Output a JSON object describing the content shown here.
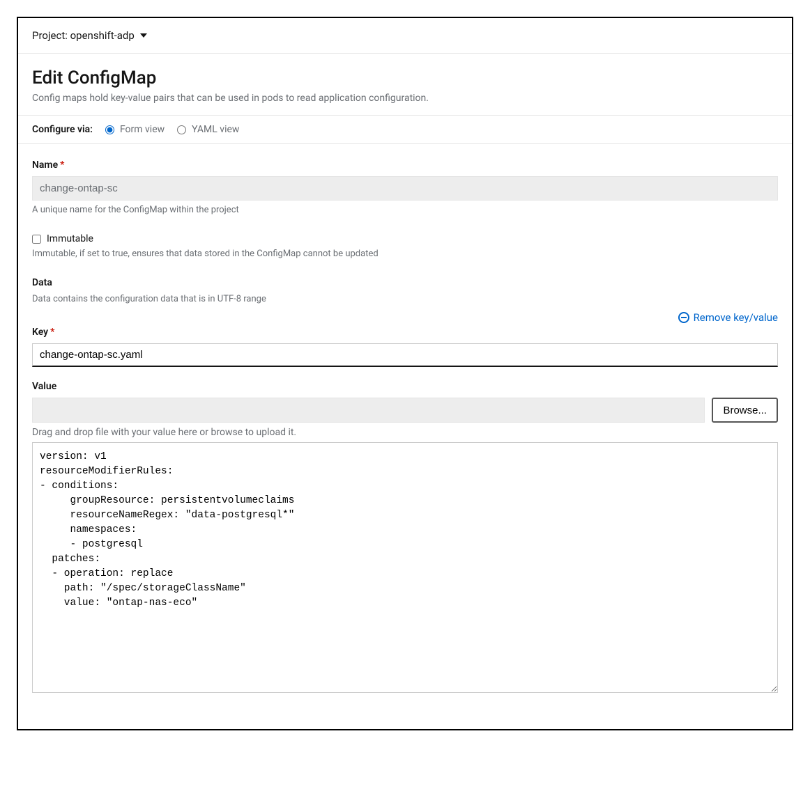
{
  "project_bar": {
    "label": "Project: openshift-adp"
  },
  "header": {
    "title": "Edit ConfigMap",
    "subtitle": "Config maps hold key-value pairs that can be used in pods to read application configuration."
  },
  "view_toggle": {
    "label": "Configure via:",
    "options": {
      "form": "Form view",
      "yaml": "YAML view"
    },
    "selected": "form"
  },
  "form": {
    "name": {
      "label": "Name",
      "value": "change-ontap-sc",
      "helper": "A unique name for the ConfigMap within the project"
    },
    "immutable": {
      "label": "Immutable",
      "checked": false,
      "helper": "Immutable, if set to true, ensures that data stored in the ConfigMap cannot be updated"
    },
    "data": {
      "label": "Data",
      "helper": "Data contains the configuration data that is in UTF-8 range",
      "remove_label": "Remove key/value",
      "key": {
        "label": "Key",
        "value": "change-ontap-sc.yaml"
      },
      "value": {
        "label": "Value",
        "browse": "Browse...",
        "drag_hint": "Drag and drop file with your value here or browse to upload it.",
        "content": "version: v1\nresourceModifierRules:\n- conditions:\n     groupResource: persistentvolumeclaims\n     resourceNameRegex: \"data-postgresql*\"\n     namespaces:\n     - postgresql\n  patches:\n  - operation: replace\n    path: \"/spec/storageClassName\"\n    value: \"ontap-nas-eco\"\n"
      }
    }
  }
}
